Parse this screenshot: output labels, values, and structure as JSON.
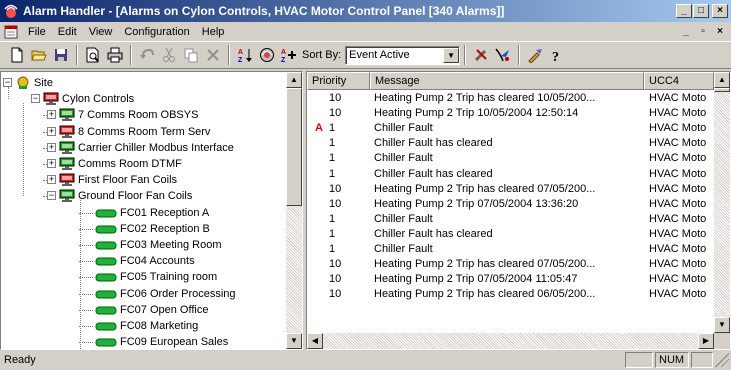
{
  "window": {
    "title": "Alarm Handler - [Alarms on Cylon Controls, HVAC Motor Control Panel [340 Alarms]]",
    "controls": [
      "_",
      "□",
      "×"
    ]
  },
  "menu": {
    "items": [
      "File",
      "Edit",
      "View",
      "Configuration",
      "Help"
    ],
    "mdi_controls": [
      "_",
      "▫",
      "×"
    ]
  },
  "toolbar": {
    "sort_label": "Sort By:",
    "sort_value": "Event Active",
    "icons": [
      "new-icon",
      "open-icon",
      "save-icon",
      "print-preview-icon",
      "print-icon",
      "undo-icon",
      "cut-icon",
      "copy-icon",
      "delete-icon",
      "sort-az-icon",
      "sort-group-icon",
      "sort-add-icon",
      "tools-icon",
      "filter-icon",
      "acknowledge-icon",
      "help-icon"
    ]
  },
  "tree": {
    "items": [
      {
        "label": "Site",
        "level": 0,
        "expanded": true,
        "icon": "site-icon"
      },
      {
        "label": "Cylon Controls",
        "level": 1,
        "expanded": true,
        "icon": "controller-red-icon"
      },
      {
        "label": "7 Comms Room OBSYS",
        "level": 2,
        "expanded": false,
        "icon": "controller-green-icon"
      },
      {
        "label": "8 Comms Room Term Serv",
        "level": 2,
        "expanded": false,
        "icon": "controller-red-icon"
      },
      {
        "label": "Carrier Chiller Modbus Interface",
        "level": 2,
        "expanded": false,
        "icon": "controller-green-icon"
      },
      {
        "label": "Comms Room DTMF",
        "level": 2,
        "expanded": false,
        "icon": "controller-green-icon"
      },
      {
        "label": "First Floor Fan Coils",
        "level": 2,
        "expanded": false,
        "icon": "controller-red-icon"
      },
      {
        "label": "Ground Floor Fan Coils",
        "level": 2,
        "expanded": true,
        "icon": "controller-green-icon"
      },
      {
        "label": "FC01 Reception A",
        "level": 3,
        "icon": "device-icon"
      },
      {
        "label": "FC02 Reception B",
        "level": 3,
        "icon": "device-icon"
      },
      {
        "label": "FC03 Meeting Room",
        "level": 3,
        "icon": "device-icon"
      },
      {
        "label": "FC04 Accounts",
        "level": 3,
        "icon": "device-icon"
      },
      {
        "label": "FC05 Training room",
        "level": 3,
        "icon": "device-icon"
      },
      {
        "label": "FC06 Order Processing",
        "level": 3,
        "icon": "device-icon"
      },
      {
        "label": "FC07 Open Office",
        "level": 3,
        "icon": "device-icon"
      },
      {
        "label": "FC08 Marketing",
        "level": 3,
        "icon": "device-icon"
      },
      {
        "label": "FC09 European Sales",
        "level": 3,
        "icon": "device-icon"
      }
    ]
  },
  "alarms": {
    "columns": [
      "Priority",
      "Message",
      "UCC4"
    ],
    "rows": [
      {
        "flag": "",
        "priority": "10",
        "message": "Heating Pump 2 Trip has cleared 10/05/200...",
        "ucc4": "HVAC Moto"
      },
      {
        "flag": "",
        "priority": "10",
        "message": "Heating Pump 2 Trip 10/05/2004 12:50:14",
        "ucc4": "HVAC Moto"
      },
      {
        "flag": "A",
        "priority": "1",
        "message": "Chiller Fault",
        "ucc4": "HVAC Moto"
      },
      {
        "flag": "",
        "priority": "1",
        "message": "Chiller Fault has cleared",
        "ucc4": "HVAC Moto"
      },
      {
        "flag": "",
        "priority": "1",
        "message": "Chiller Fault",
        "ucc4": "HVAC Moto"
      },
      {
        "flag": "",
        "priority": "1",
        "message": "Chiller Fault has cleared",
        "ucc4": "HVAC Moto"
      },
      {
        "flag": "",
        "priority": "10",
        "message": "Heating Pump 2 Trip has cleared 07/05/200...",
        "ucc4": "HVAC Moto"
      },
      {
        "flag": "",
        "priority": "10",
        "message": "Heating Pump 2 Trip 07/05/2004 13:36:20",
        "ucc4": "HVAC Moto"
      },
      {
        "flag": "",
        "priority": "1",
        "message": "Chiller Fault",
        "ucc4": "HVAC Moto"
      },
      {
        "flag": "",
        "priority": "1",
        "message": "Chiller Fault has cleared",
        "ucc4": "HVAC Moto"
      },
      {
        "flag": "",
        "priority": "1",
        "message": "Chiller Fault",
        "ucc4": "HVAC Moto"
      },
      {
        "flag": "",
        "priority": "10",
        "message": "Heating Pump 2 Trip has cleared 07/05/200...",
        "ucc4": "HVAC Moto"
      },
      {
        "flag": "",
        "priority": "10",
        "message": "Heating Pump 2 Trip 07/05/2004 11:05:47",
        "ucc4": "HVAC Moto"
      },
      {
        "flag": "",
        "priority": "10",
        "message": "Heating Pump 2 Trip has cleared 06/05/200...",
        "ucc4": "HVAC Moto"
      }
    ]
  },
  "status": {
    "text": "Ready",
    "panels": [
      "",
      "NUM",
      ""
    ]
  },
  "colors": {
    "titlebar_start": "#0a246a",
    "titlebar_end": "#a6caf0",
    "alarm_flag": "#e00000",
    "face": "#d4d0c8"
  }
}
